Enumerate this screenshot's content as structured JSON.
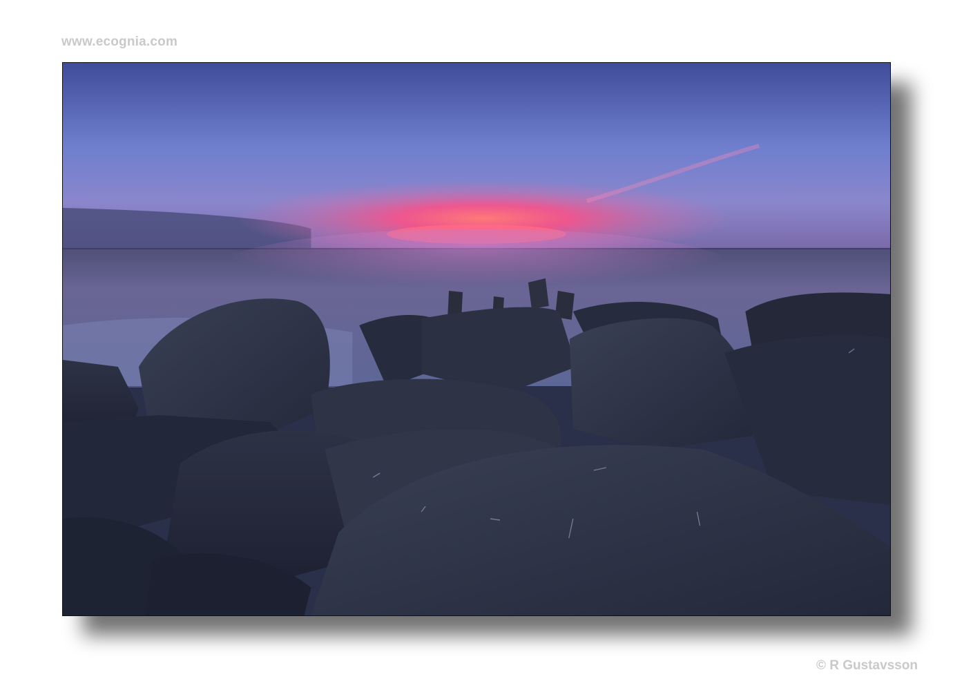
{
  "header": {
    "site_url": "www.ecognia.com"
  },
  "footer": {
    "credit": "© R Gustavsson"
  },
  "photo": {
    "subject": "sunset over sea with breakwater rocks",
    "colors": {
      "sky_top": "#4a5aa8",
      "sky_mid": "#7f8fd6",
      "glow_pink": "#ff5f8c",
      "glow_core": "#ff8a7a",
      "sea": "#5a5e8a",
      "rock_dark": "#1e2236",
      "rock_mid": "#2f3446"
    }
  }
}
